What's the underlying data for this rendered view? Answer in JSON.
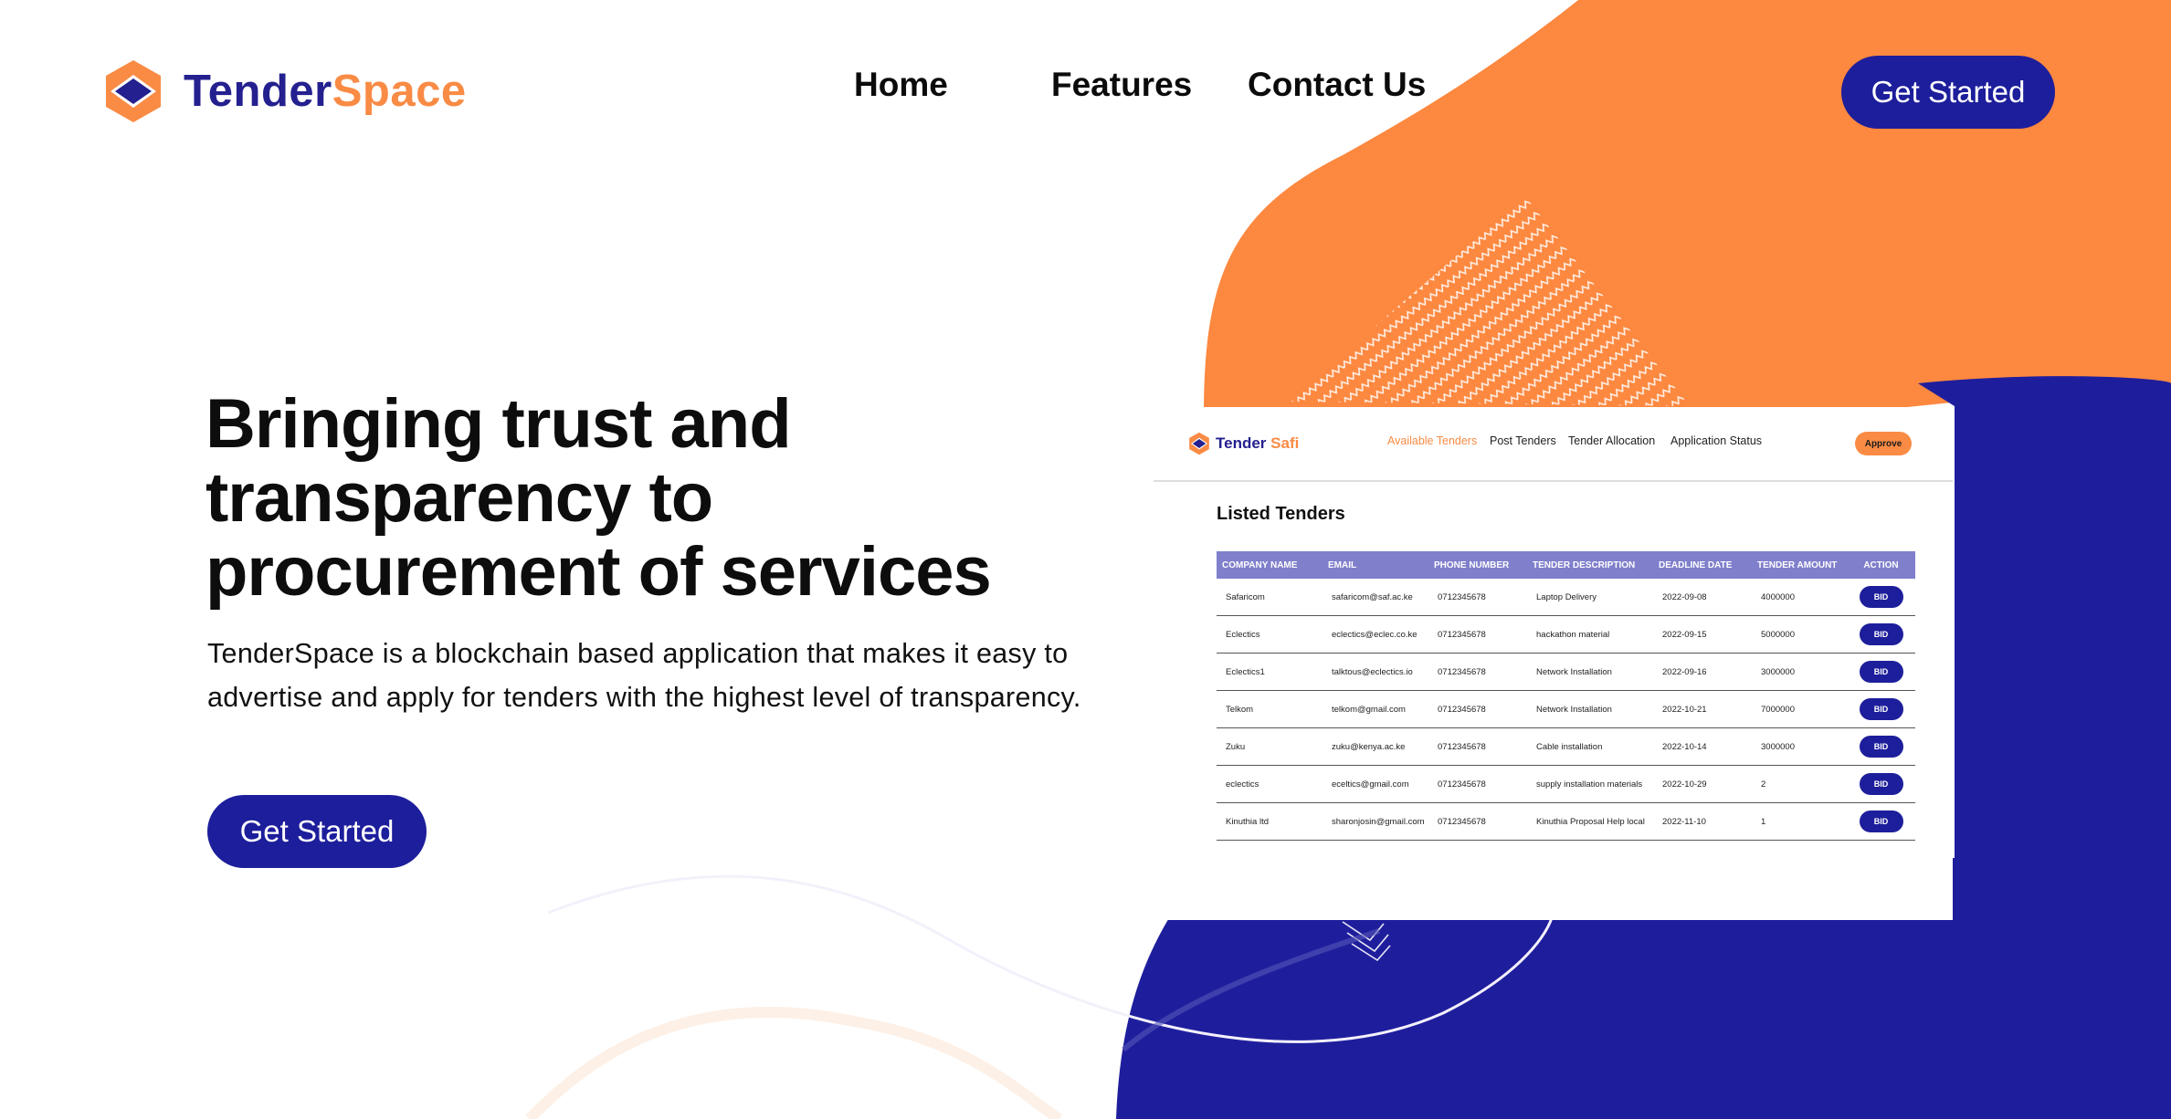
{
  "brand": {
    "name_part1": "Tender",
    "name_part2": "Space",
    "color_primary": "#24208f",
    "color_accent": "#f98b45"
  },
  "nav": {
    "home": "Home",
    "features": "Features",
    "contact": "Contact Us"
  },
  "header_cta": "Get Started",
  "hero": {
    "title": "Bringing trust and transparency to procurement of services",
    "description": "TenderSpace is a blockchain based application that makes it easy to advertise and apply for tenders with the highest level of transparency.",
    "cta": "Get Started"
  },
  "preview": {
    "brand_part1": "Tender",
    "brand_part2": "Safi",
    "nav": [
      "Available Tenders",
      "Post Tenders",
      "Tender Allocation",
      "Application Status"
    ],
    "approve_button": "Approve",
    "section_title": "Listed Tenders",
    "table": {
      "headers": [
        "Company Name",
        "Email",
        "Phone Number",
        "Tender Description",
        "Deadline Date",
        "Tender Amount",
        "Action"
      ],
      "rows": [
        {
          "company": "Safaricom",
          "email": "safaricom@saf.ac.ke",
          "phone": "0712345678",
          "description": "Laptop Delivery",
          "deadline": "2022-09-08",
          "amount": "4000000",
          "action": "BID"
        },
        {
          "company": "Eclectics",
          "email": "eclectics@eclec.co.ke",
          "phone": "0712345678",
          "description": "hackathon material",
          "deadline": "2022-09-15",
          "amount": "5000000",
          "action": "BID"
        },
        {
          "company": "Eclectics1",
          "email": "talktous@eclectics.io",
          "phone": "0712345678",
          "description": "Network Installation",
          "deadline": "2022-09-16",
          "amount": "3000000",
          "action": "BID"
        },
        {
          "company": "Telkom",
          "email": "telkom@gmail.com",
          "phone": "0712345678",
          "description": "Network Installation",
          "deadline": "2022-10-21",
          "amount": "7000000",
          "action": "BID"
        },
        {
          "company": "Zuku",
          "email": "zuku@kenya.ac.ke",
          "phone": "0712345678",
          "description": "Cable installation",
          "deadline": "2022-10-14",
          "amount": "3000000",
          "action": "BID"
        },
        {
          "company": "eclectics",
          "email": "eceltics@gmail.com",
          "phone": "0712345678",
          "description": "supply installation materials",
          "deadline": "2022-10-29",
          "amount": "2",
          "action": "BID"
        },
        {
          "company": "Kinuthia ltd",
          "email": "sharonjosin@gmail.com",
          "phone": "0712345678",
          "description": "Kinuthia Proposal Help local",
          "deadline": "2022-11-10",
          "amount": "1",
          "action": "BID"
        }
      ]
    }
  }
}
